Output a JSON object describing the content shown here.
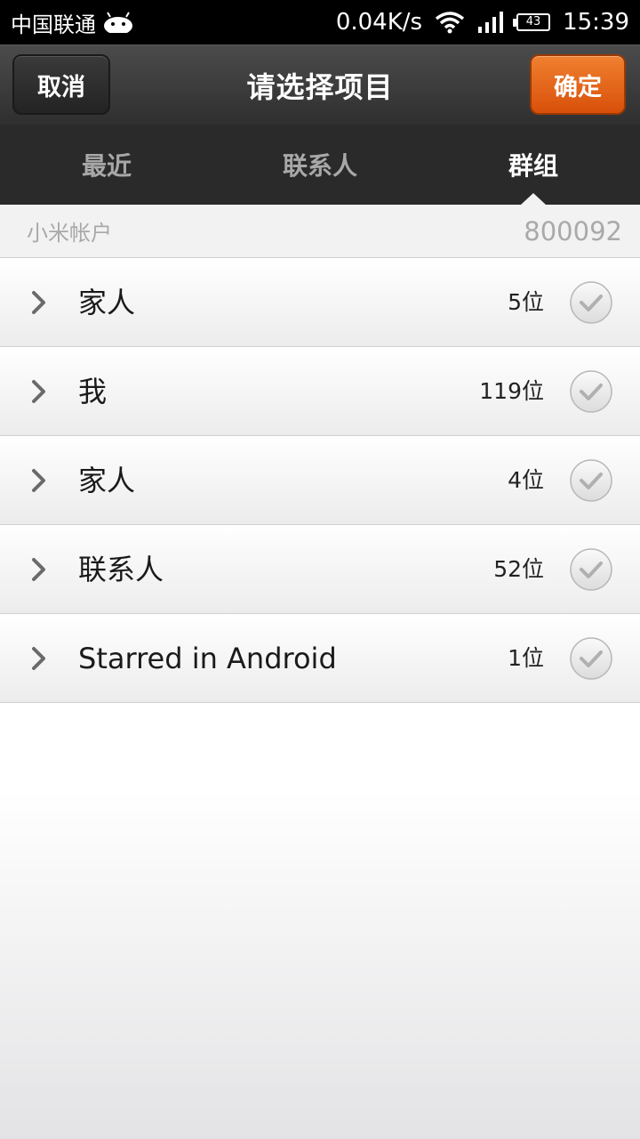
{
  "status_bar": {
    "carrier": "中国联通",
    "net_speed": "0.04K/s",
    "battery": "43",
    "time": "15:39"
  },
  "title_bar": {
    "cancel_label": "取消",
    "title": "请选择项目",
    "ok_label": "确定",
    "ok_color": "#e1631a"
  },
  "tabs": [
    {
      "label": "最近",
      "active": false
    },
    {
      "label": "联系人",
      "active": false
    },
    {
      "label": "群组",
      "active": true
    }
  ],
  "account": {
    "label": "小米帐户",
    "value": "800092"
  },
  "groups": [
    {
      "name": "家人",
      "count": "5位"
    },
    {
      "name": "我",
      "count": "119位"
    },
    {
      "name": "家人",
      "count": "4位"
    },
    {
      "name": "联系人",
      "count": "52位"
    },
    {
      "name": "Starred in Android",
      "count": "1位"
    }
  ]
}
